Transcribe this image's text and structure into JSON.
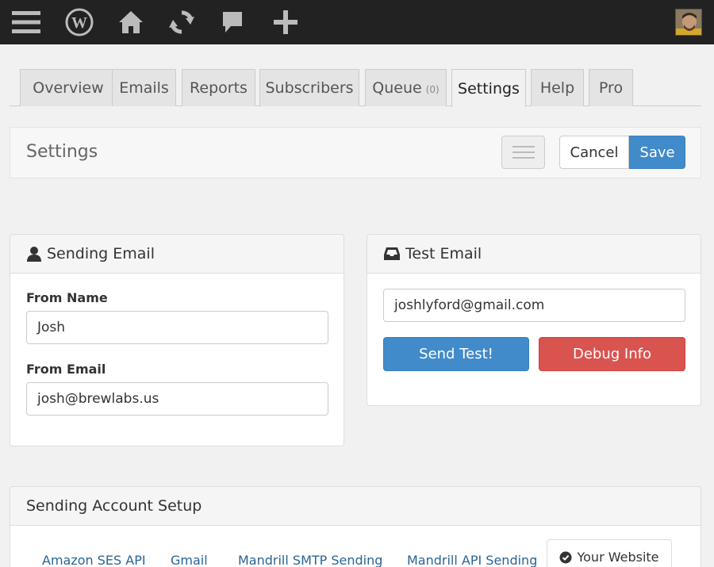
{
  "adminbar": {
    "icons": [
      "menu-icon",
      "wordpress-icon",
      "home-icon",
      "updates-icon",
      "comments-icon",
      "new-content-icon"
    ]
  },
  "tabs": [
    {
      "label": "Overview"
    },
    {
      "label": "Emails"
    },
    {
      "label": "Reports"
    },
    {
      "label": "Subscribers"
    },
    {
      "label": "Queue",
      "count": "(0)"
    },
    {
      "label": "Settings",
      "active": true
    },
    {
      "label": "Help"
    },
    {
      "label": "Pro"
    }
  ],
  "header": {
    "title": "Settings",
    "cancel_label": "Cancel",
    "save_label": "Save"
  },
  "sending_email": {
    "title": "Sending Email",
    "from_name_label": "From Name",
    "from_name_value": "Josh",
    "from_email_label": "From Email",
    "from_email_value": "josh@brewlabs.us"
  },
  "test_email": {
    "title": "Test Email",
    "email_value": "joshlyford@gmail.com",
    "send_label": "Send Test!",
    "debug_label": "Debug Info"
  },
  "account_setup": {
    "title": "Sending Account Setup",
    "options": [
      "Amazon SES API",
      "Gmail",
      "Mandrill SMTP Sending",
      "Mandrill API Sending"
    ],
    "active_option": "Your Website"
  },
  "colors": {
    "adminbar": "#222222",
    "primary": "#428bca",
    "danger": "#d9534f",
    "link": "#2a6496"
  }
}
